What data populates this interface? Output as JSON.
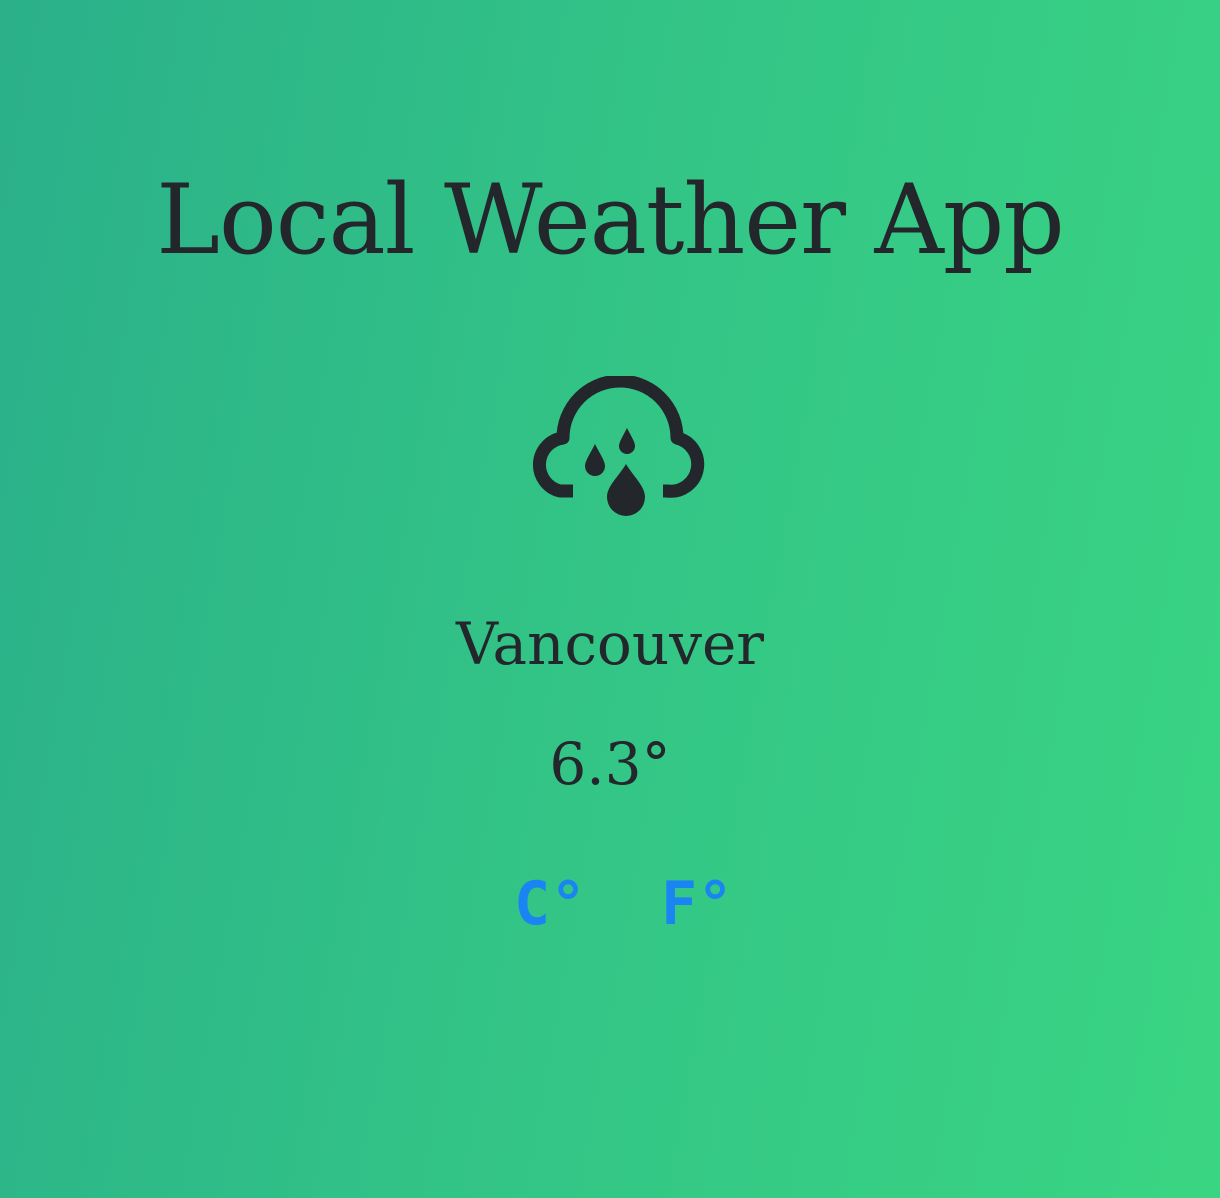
{
  "app": {
    "title": "Local Weather App"
  },
  "weather": {
    "icon": "rain-cloud-icon",
    "city": "Vancouver",
    "temperature": "6.3°"
  },
  "units": {
    "celsius_label": "C°",
    "fahrenheit_label": "F°"
  },
  "colors": {
    "background_start": "#2bb08a",
    "background_end": "#3ad583",
    "text": "#23262b",
    "unit_link": "#1a85f2"
  }
}
